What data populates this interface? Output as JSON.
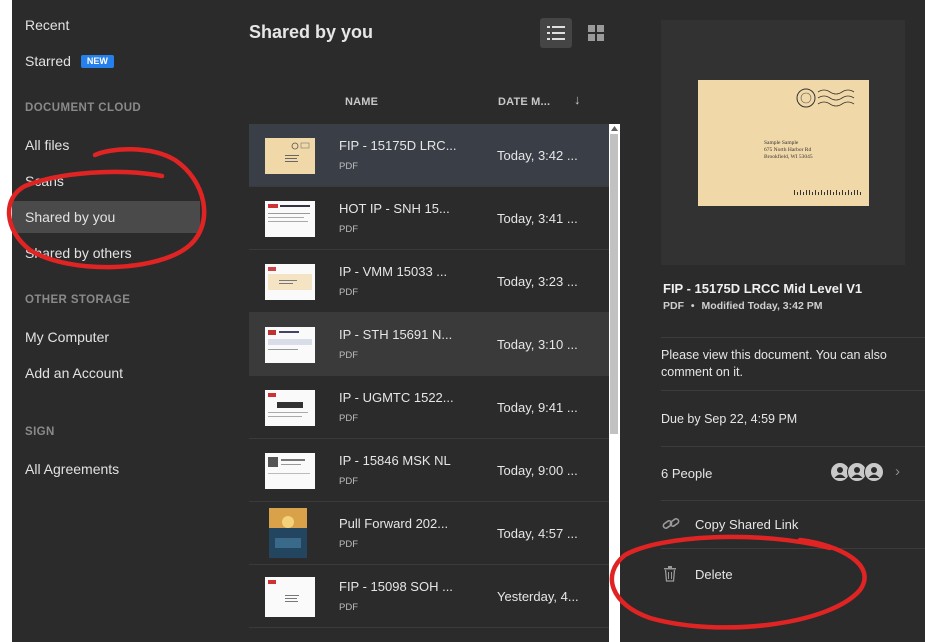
{
  "sidebar": {
    "recent": "Recent",
    "starred": "Starred",
    "new_badge": "NEW",
    "section_document_cloud": "DOCUMENT CLOUD",
    "all_files": "All files",
    "scans": "Scans",
    "shared_by_you": "Shared by you",
    "shared_by_others": "Shared by others",
    "section_other_storage": "OTHER STORAGE",
    "my_computer": "My Computer",
    "add_account": "Add an Account",
    "section_sign": "SIGN",
    "all_agreements": "All Agreements"
  },
  "main": {
    "title": "Shared by you",
    "col_name": "NAME",
    "col_date": "DATE M...",
    "files": [
      {
        "name": "FIP - 15175D LRC...",
        "type": "PDF",
        "date": "Today, 3:42 ..."
      },
      {
        "name": "HOT IP - SNH 15...",
        "type": "PDF",
        "date": "Today, 3:41 ..."
      },
      {
        "name": "IP - VMM 15033 ...",
        "type": "PDF",
        "date": "Today, 3:23 ..."
      },
      {
        "name": "IP - STH 15691 N...",
        "type": "PDF",
        "date": "Today, 3:10 ..."
      },
      {
        "name": "IP - UGMTC 1522...",
        "type": "PDF",
        "date": "Today, 9:41 ..."
      },
      {
        "name": "IP - 15846 MSK NL",
        "type": "PDF",
        "date": "Today, 9:00 ..."
      },
      {
        "name": "Pull Forward 202...",
        "type": "PDF",
        "date": "Today, 4:57 ..."
      },
      {
        "name": "FIP - 15098 SOH ...",
        "type": "PDF",
        "date": "Yesterday, 4..."
      }
    ]
  },
  "details": {
    "title": "FIP - 15175D LRCC Mid Level V1",
    "type": "PDF",
    "modified": "Modified Today, 3:42 PM",
    "bullet": "•",
    "message": "Please view this document. You can also comment on it.",
    "due": "Due by Sep 22, 4:59 PM",
    "people": "6 People",
    "copy_link": "Copy Shared Link",
    "delete": "Delete",
    "envelope_lines": [
      "Sample Sample",
      "675 North Harbor Rd",
      "Brookfield, WI 53045"
    ]
  },
  "colors": {
    "background": "#2b2b2b",
    "selected_row": "#3a3f47",
    "active_nav": "#4a4a4a",
    "badge": "#2680eb",
    "annotation": "#e02424",
    "envelope": "#f1d8a8"
  },
  "icons": [
    "list-view-icon",
    "grid-view-icon",
    "sort-desc-icon",
    "link-icon",
    "trash-icon",
    "person-icon",
    "chevron-right-icon"
  ]
}
